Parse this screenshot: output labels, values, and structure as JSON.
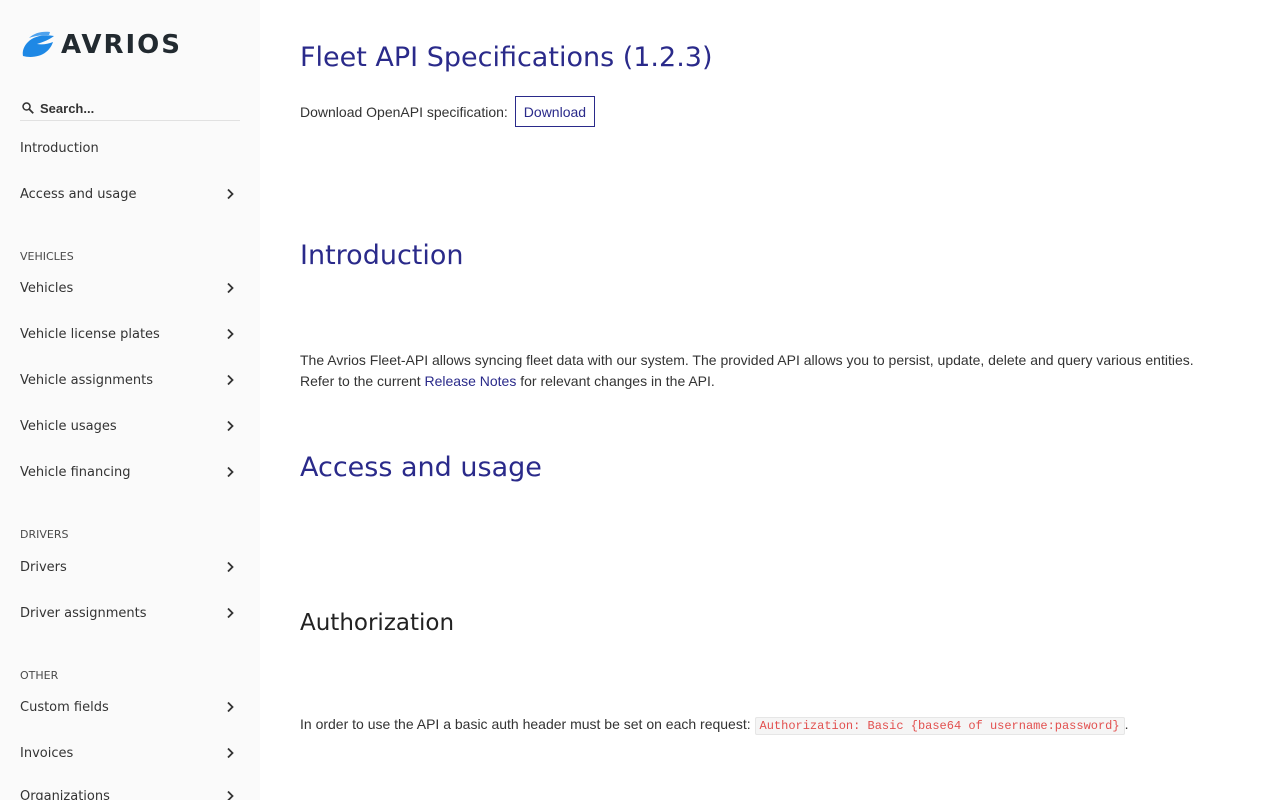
{
  "brand": {
    "name": "AVRIOS",
    "accent": "#1e88e5"
  },
  "search": {
    "placeholder": "Search..."
  },
  "sidebar": {
    "top_items": [
      {
        "label": "Introduction",
        "has_chevron": false
      },
      {
        "label": "Access and usage",
        "has_chevron": true
      }
    ],
    "sections": [
      {
        "title": "VEHICLES",
        "items": [
          "Vehicles",
          "Vehicle license plates",
          "Vehicle assignments",
          "Vehicle usages",
          "Vehicle financing"
        ]
      },
      {
        "title": "DRIVERS",
        "items": [
          "Drivers",
          "Driver assignments"
        ]
      },
      {
        "title": "OTHER",
        "items": [
          "Custom fields",
          "Invoices",
          "Organizations"
        ]
      }
    ]
  },
  "main": {
    "title": "Fleet API Specifications (1.2.3)",
    "download_label": "Download OpenAPI specification:",
    "download_button": "Download",
    "intro_heading": "Introduction",
    "intro_text_before": "The Avrios Fleet-API allows syncing fleet data with our system. The provided API allows you to persist, update, delete and query various entities. Refer to the current ",
    "intro_link": "Release Notes",
    "intro_text_after": " for relevant changes in the API.",
    "access_heading": "Access and usage",
    "auth_heading": "Authorization",
    "auth_text": "In order to use the API a basic auth header must be set on each request: ",
    "auth_code": "Authorization: Basic {base64 of username:password}",
    "auth_end": "."
  },
  "colors": {
    "heading": "#2a2a8a",
    "code": "#e2504f",
    "sidebar_bg": "#fafafa"
  }
}
